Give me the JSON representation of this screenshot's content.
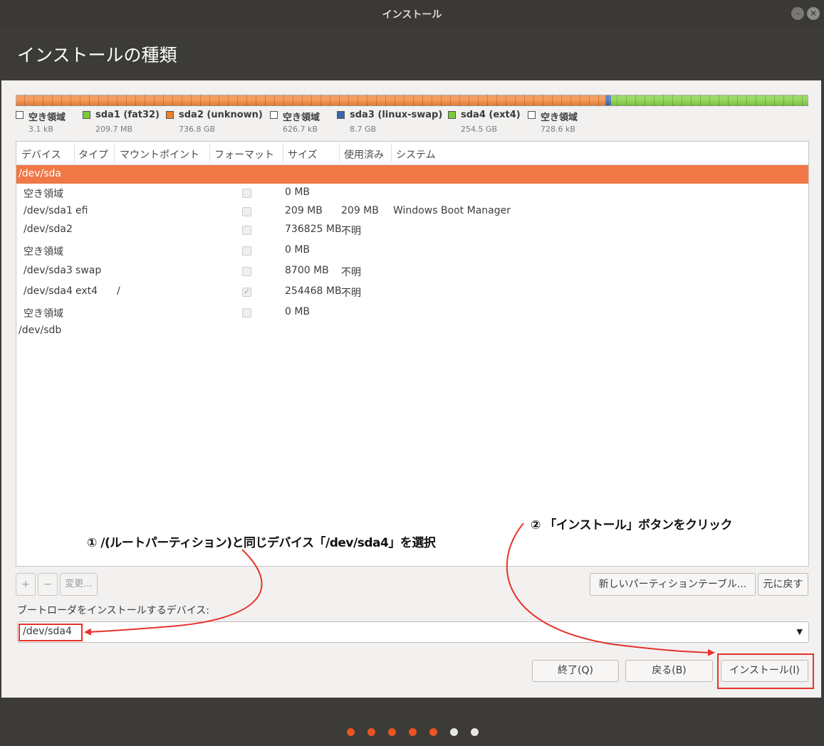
{
  "window": {
    "title": "インストール"
  },
  "header": {
    "title": "インストールの種類"
  },
  "partition_bar": [
    {
      "color": "#f07f2d",
      "fraction": 0.002
    },
    {
      "color": "#f07f2d",
      "fraction": 0.742
    },
    {
      "color": "#3a66b0",
      "fraction": 0.008
    },
    {
      "color": "#79cc36",
      "fraction": 0.248
    }
  ],
  "legend": [
    {
      "name": "空き領域",
      "size": "3.1 kB",
      "color": "#ffffff"
    },
    {
      "name": "sda1 (fat32)",
      "size": "209.7 MB",
      "color": "#79cc36"
    },
    {
      "name": "sda2 (unknown)",
      "size": "736.8 GB",
      "color": "#f07f2d"
    },
    {
      "name": "空き領域",
      "size": "626.7 kB",
      "color": "#ffffff"
    },
    {
      "name": "sda3 (linux-swap)",
      "size": "8.7 GB",
      "color": "#3a66b0"
    },
    {
      "name": "sda4 (ext4)",
      "size": "254.5 GB",
      "color": "#79cc36"
    },
    {
      "name": "空き領域",
      "size": "728.6 kB",
      "color": "#ffffff"
    }
  ],
  "table": {
    "columns": [
      "デバイス",
      "タイプ",
      "マウントポイント",
      "フォーマット",
      "サイズ",
      "使用済み",
      "システム"
    ],
    "rows": [
      {
        "device": "/dev/sda",
        "type": "",
        "mount": "",
        "format": null,
        "size": "",
        "used": "",
        "system": ""
      },
      {
        "device": "空き領域",
        "type": "",
        "mount": "",
        "format": false,
        "size": "0 MB",
        "used": "",
        "system": ""
      },
      {
        "device": "/dev/sda1",
        "type": "efi",
        "mount": "",
        "format": false,
        "size": "209 MB",
        "used": "209 MB",
        "system": "Windows Boot Manager"
      },
      {
        "device": "/dev/sda2",
        "type": "",
        "mount": "",
        "format": false,
        "size": "736825 MB",
        "used": "不明",
        "system": ""
      },
      {
        "device": "空き領域",
        "type": "",
        "mount": "",
        "format": false,
        "size": "0 MB",
        "used": "",
        "system": ""
      },
      {
        "device": "/dev/sda3",
        "type": "swap",
        "mount": "",
        "format": false,
        "size": "8700 MB",
        "used": "不明",
        "system": ""
      },
      {
        "device": "/dev/sda4",
        "type": "ext4",
        "mount": "/",
        "format": true,
        "size": "254468 MB",
        "used": "不明",
        "system": ""
      },
      {
        "device": "空き領域",
        "type": "",
        "mount": "",
        "format": false,
        "size": "0 MB",
        "used": "",
        "system": ""
      },
      {
        "device": "/dev/sdb",
        "type": "",
        "mount": "",
        "format": null,
        "size": "",
        "used": "",
        "system": ""
      }
    ]
  },
  "annotations": {
    "step1": "① /(ルートパーティション)と同じデバイス「/dev/sda4」を選択",
    "step2": "② 「インストール」ボタンをクリック"
  },
  "toolbar": {
    "add_label": "+",
    "remove_label": "−",
    "change_label": "変更...",
    "new_table_label": "新しいパーティションテーブル...",
    "revert_label": "元に戻す"
  },
  "bootloader": {
    "label": "ブートローダをインストールするデバイス:",
    "value": "/dev/sda4"
  },
  "nav": {
    "quit_label": "終了(Q)",
    "back_label": "戻る(B)",
    "install_label": "インストール(I)"
  },
  "progress_dots": {
    "total": 7,
    "done": 5,
    "done_color": "#e95420",
    "todo_color": "#e8e6e3"
  }
}
